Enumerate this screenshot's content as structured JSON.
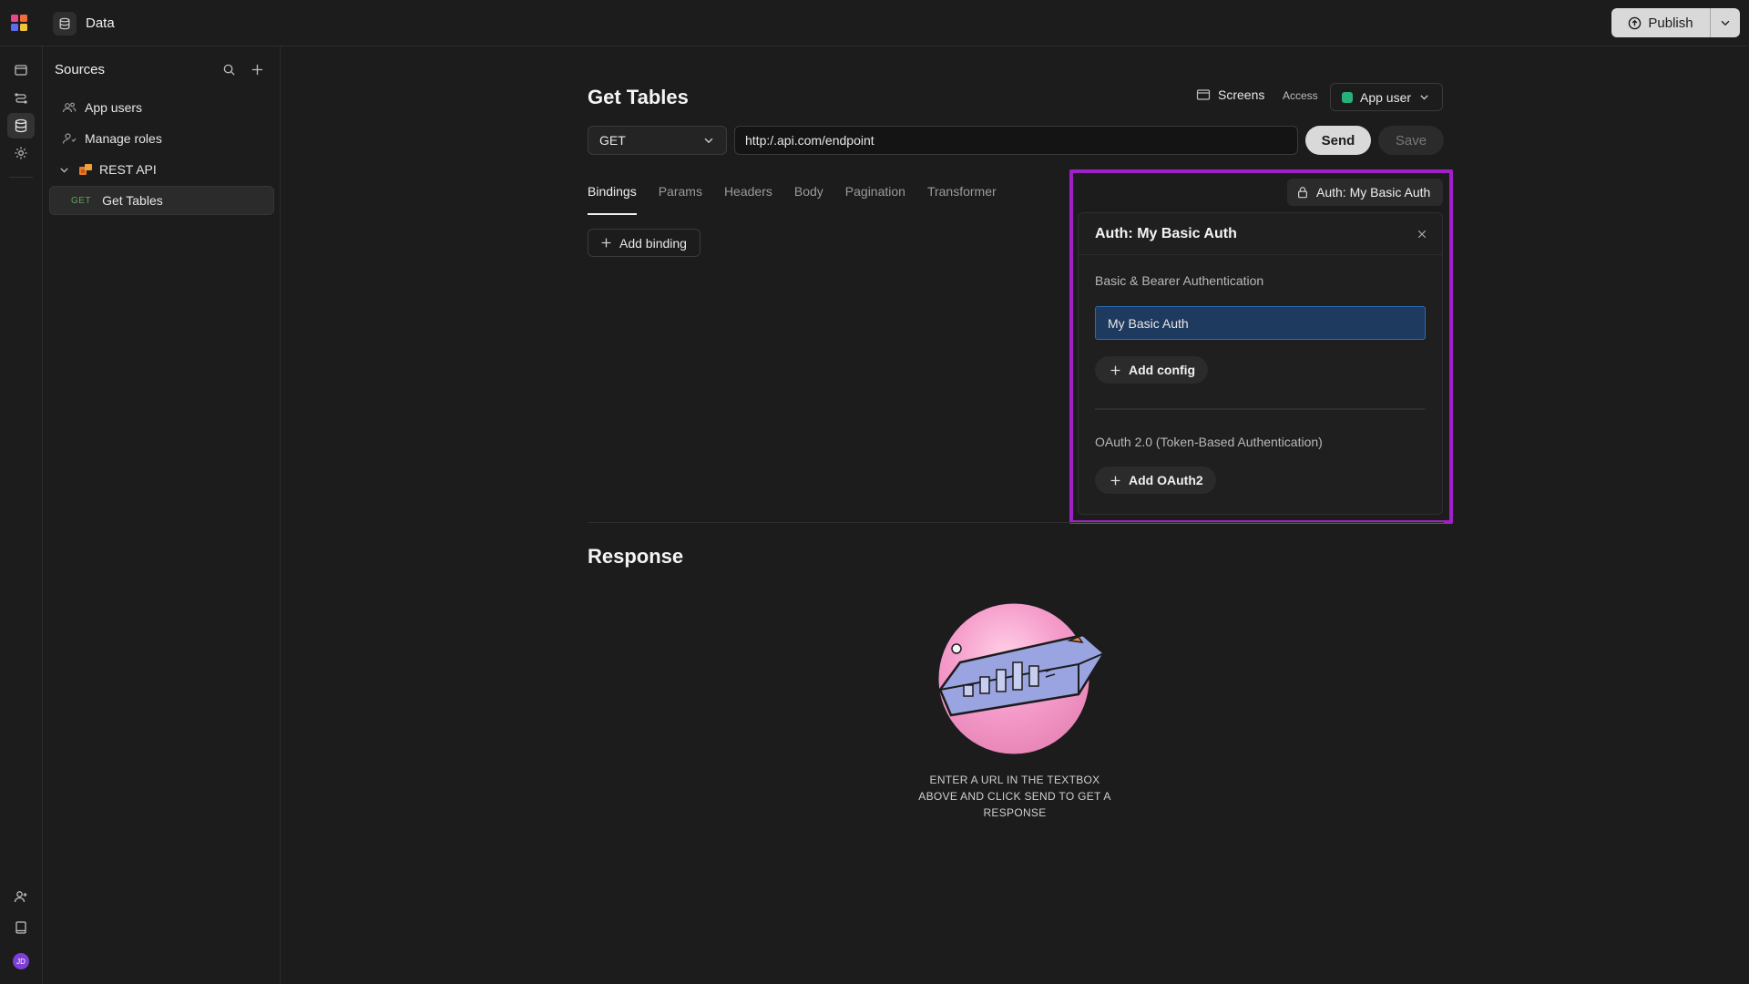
{
  "app": {
    "title": "Data"
  },
  "publish": {
    "label": "Publish"
  },
  "sidebar": {
    "title": "Sources",
    "items": [
      {
        "label": "App users"
      },
      {
        "label": "Manage roles"
      },
      {
        "label": "REST API"
      },
      {
        "method": "GET",
        "label": "Get Tables"
      }
    ]
  },
  "main": {
    "title": "Get Tables",
    "screens_label": "Screens",
    "access_label": "Access",
    "role": "App user",
    "method": "GET",
    "url": "http:/.api.com/endpoint",
    "send_label": "Send",
    "save_label": "Save",
    "tabs": [
      {
        "label": "Bindings",
        "active": true
      },
      {
        "label": "Params"
      },
      {
        "label": "Headers"
      },
      {
        "label": "Body"
      },
      {
        "label": "Pagination"
      },
      {
        "label": "Transformer"
      }
    ],
    "add_binding_label": "Add binding",
    "response_title": "Response",
    "empty_message": "ENTER A URL IN THE TEXTBOX ABOVE AND CLICK SEND TO GET A RESPONSE"
  },
  "auth": {
    "chip_label": "Auth: My Basic Auth",
    "panel_title": "Auth: My Basic Auth",
    "basic_section": "Basic & Bearer Authentication",
    "basic_item": "My Basic Auth",
    "add_config_label": "Add config",
    "oauth_section": "OAuth 2.0 (Token-Based Authentication)",
    "add_oauth_label": "Add OAuth2"
  },
  "user": {
    "initials": "JD"
  },
  "colors": {
    "background": "#1c1c1c",
    "highlight": "#a020c8",
    "selected_item": "#1e3a5f",
    "role_dot": "#27b07a",
    "avatar": "#7e3fd6"
  }
}
